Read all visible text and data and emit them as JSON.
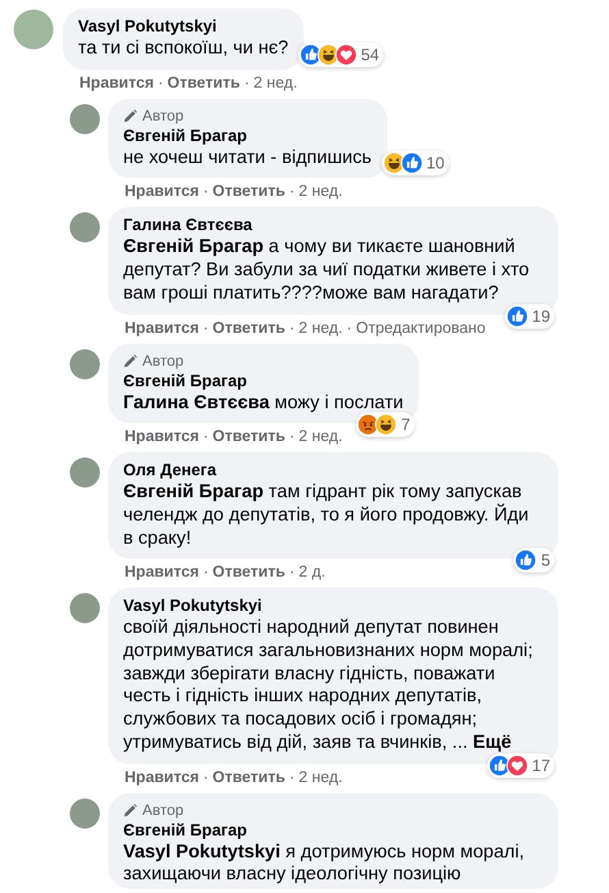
{
  "separator": "·",
  "comments": [
    {
      "reply": false,
      "name": "Vasyl Pokutytskyi",
      "text": "та ти сі вспокоїш, чи нє?",
      "reactions": {
        "count": "54",
        "icons": [
          {
            "kind": "like"
          },
          {
            "kind": "haha"
          },
          {
            "kind": "love"
          }
        ]
      },
      "actions": {
        "like": "Нравится",
        "reply": "Ответить",
        "time": "2 нед."
      }
    },
    {
      "reply": true,
      "author_badge": "Автор",
      "name": "Євгеній Брагар",
      "text": "не хочеш читати - відпишись",
      "reactions": {
        "count": "10",
        "icons": [
          {
            "kind": "haha"
          },
          {
            "kind": "like"
          }
        ]
      },
      "actions": {
        "like": "Нравится",
        "reply": "Ответить",
        "time": "2 нед."
      }
    },
    {
      "reply": true,
      "name": "Галина Євтєєва",
      "text": "**Євгеній Брагар** а чому ви тикаєте шановний депутат? Ви забули за чиї податки живете і хто вам гроші платить????може вам нагадати?",
      "reactions": {
        "count": "19",
        "icons": [
          {
            "kind": "like"
          }
        ]
      },
      "actions": {
        "like": "Нравится",
        "reply": "Ответить",
        "time": "2 нед.",
        "edited": "Отредактировано"
      }
    },
    {
      "reply": true,
      "author_badge": "Автор",
      "name": "Євгеній Брагар",
      "text": "**Галина Євтєєва** можу і послати",
      "reactions": {
        "count": "7",
        "icons": [
          {
            "kind": "angry"
          },
          {
            "kind": "haha"
          }
        ]
      },
      "actions": {
        "like": "Нравится",
        "reply": "Ответить",
        "time": "2 нед."
      }
    },
    {
      "reply": true,
      "name": "Оля Денега",
      "text": "**Євгеній Брагар** там гідрант рік тому запускав челендж до депутатів, то я його продовжу. Йди в сраку!",
      "reactions": {
        "count": "5",
        "icons": [
          {
            "kind": "like"
          }
        ]
      },
      "actions": {
        "like": "Нравится",
        "reply": "Ответить",
        "time": "2 д."
      }
    },
    {
      "reply": true,
      "name": "Vasyl Pokutytskyi",
      "text": "своїй діяльності народний депутат повинен дотримуватися загальновизнаних норм моралі; завжди зберігати власну гідність, поважати честь і гідність інших народних депутатів, службових та посадових осіб і громадян; утримуватись від дій, заяв та вчинків, ... **Ещё**",
      "reactions": {
        "count": "17",
        "icons": [
          {
            "kind": "like"
          },
          {
            "kind": "love"
          }
        ]
      },
      "actions": {
        "like": "Нравится",
        "reply": "Ответить",
        "time": "2 нед."
      }
    },
    {
      "reply": true,
      "author_badge": "Автор",
      "name": "Євгеній Брагар",
      "text": "**Vasyl Pokutytskyi** я дотримуюсь норм моралі, захищаючи власну ідеологічну позицію"
    }
  ]
}
